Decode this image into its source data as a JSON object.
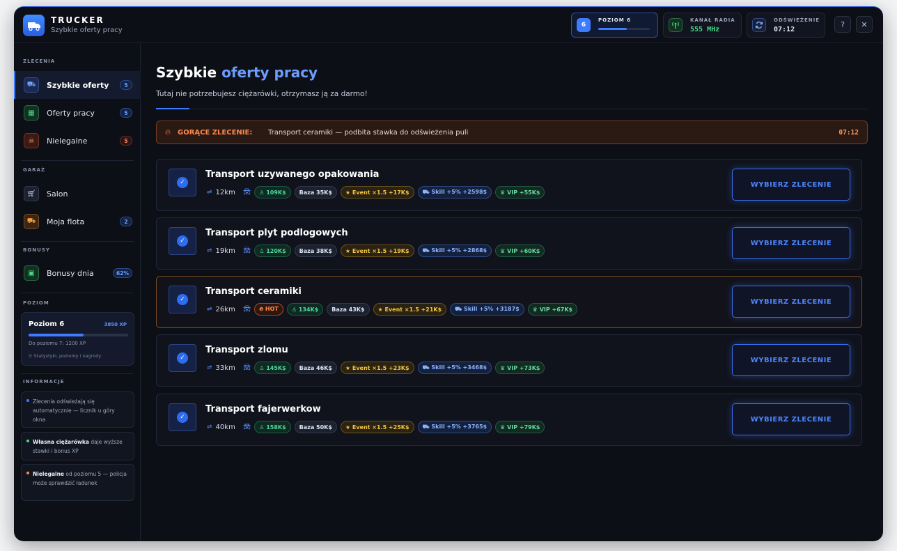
{
  "header": {
    "app_title": "TRUCKER",
    "app_subtitle": "Szybkie oferty pracy",
    "level_badge": "6",
    "level_label": "POZIOM 6",
    "level_progress": 0.55,
    "radio_label": "KANAŁ RADIA",
    "radio_value": "555 MHz",
    "refresh_label": "ODŚWIEŻENIE",
    "refresh_value": "07:12",
    "help_label": "?",
    "close_label": "✕",
    "icons": {
      "logo": "truck-icon",
      "radio": "radio-tower-icon",
      "refresh": "refresh-icon"
    }
  },
  "sidebar": {
    "sections": {
      "orders": "ZLECENIA",
      "garage": "GARAŻ",
      "bonuses": "BONUSY",
      "level": "POZIOM",
      "info": "INFORMACJE"
    },
    "orders": [
      {
        "label": "Szybkie oferty",
        "badge": "5",
        "icon": "quick-truck-icon"
      },
      {
        "label": "Oferty pracy",
        "badge": "5",
        "icon": "briefcase-icon"
      },
      {
        "label": "Nielegalne",
        "badge": "5",
        "icon": "skull-icon"
      }
    ],
    "garage": [
      {
        "label": "Salon",
        "icon": "cart-icon"
      },
      {
        "label": "Moja flota",
        "badge": "2",
        "icon": "truck-icon"
      }
    ],
    "bonuses": [
      {
        "label": "Bonusy dnia",
        "badge": "62%",
        "icon": "gift-icon"
      }
    ],
    "level_card": {
      "title": "Poziom 6",
      "xp": "3850 XP",
      "progress": 0.55,
      "next": "Do poziomu 7: 1200 XP",
      "link": "Statystyki, poziomy i nagrody"
    },
    "info": [
      {
        "bold": "",
        "text": "Zlecenia odświeżają się automatycznie — licznik u góry okna"
      },
      {
        "bold": "Własna ciężarówka",
        "text": " daje wyższe stawki i bonus XP"
      },
      {
        "bold": "Nielegalne",
        "text": " od poziomu 5 — policja może sprawdzić ładunek"
      }
    ]
  },
  "main": {
    "title_plain": "Szybkie ",
    "title_accent": "oferty pracy",
    "subtitle": "Tutaj nie potrzebujesz ciężarówki, otrzymasz ją za darmo!",
    "hot_banner": {
      "head": "GORĄCE ZLECENIE:",
      "text": "Transport ceramiki — podbita stawka do odświeżenia puli",
      "time": "07:12"
    },
    "button_label": "WYBIERZ ZLECENIE",
    "hot_label": "HOT",
    "jobs": [
      {
        "title": "Transport uzywanego opakowania",
        "distance": "12km",
        "pay": "109K$",
        "base": "Baza 35K$",
        "event": "Event ×1.5 +17K$",
        "skill": "Skill +5% +2598$",
        "vip": "VIP +55K$",
        "hot": false
      },
      {
        "title": "Transport plyt podlogowych",
        "distance": "19km",
        "pay": "120K$",
        "base": "Baza 38K$",
        "event": "Event ×1.5 +19K$",
        "skill": "Skill +5% +2868$",
        "vip": "VIP +60K$",
        "hot": false
      },
      {
        "title": "Transport ceramiki",
        "distance": "26km",
        "pay": "134K$",
        "base": "Baza 43K$",
        "event": "Event ×1.5 +21K$",
        "skill": "Skill +5% +3187$",
        "vip": "VIP +67K$",
        "hot": true
      },
      {
        "title": "Transport zlomu",
        "distance": "33km",
        "pay": "145K$",
        "base": "Baza 46K$",
        "event": "Event ×1.5 +23K$",
        "skill": "Skill +5% +3468$",
        "vip": "VIP +73K$",
        "hot": false
      },
      {
        "title": "Transport fajerwerkow",
        "distance": "40km",
        "pay": "158K$",
        "base": "Baza 50K$",
        "event": "Event ×1.5 +25K$",
        "skill": "Skill +5% +3765$",
        "vip": "VIP +79K$",
        "hot": false
      }
    ]
  },
  "colors": {
    "accent": "#3d7bff",
    "hot": "#ff8a4a",
    "background": "#0d0f17"
  }
}
